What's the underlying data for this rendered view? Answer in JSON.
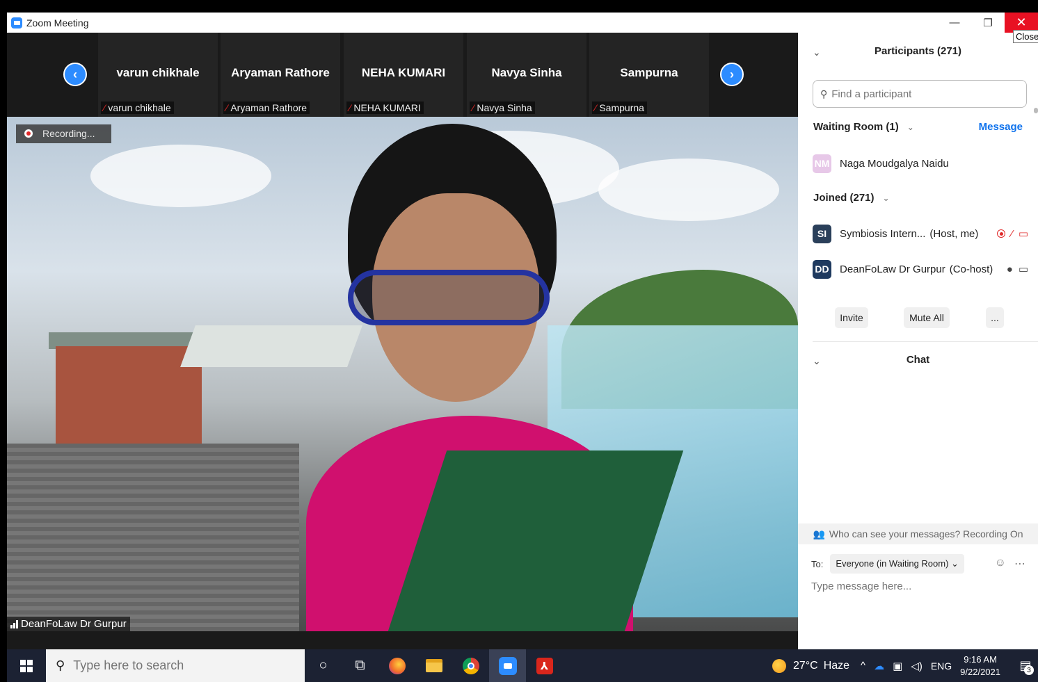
{
  "window": {
    "title": "Zoom Meeting",
    "minimize_glyph": "—",
    "restore_glyph": "❐",
    "close_glyph": "✕",
    "close_tooltip": "Close"
  },
  "thumbnails": {
    "prev_glyph": "‹",
    "next_glyph": "›",
    "items": [
      {
        "name": "varun chikhale",
        "label": "varun chikhale"
      },
      {
        "name": "Aryaman Rathore",
        "label": "Aryaman Rathore"
      },
      {
        "name": "NEHA KUMARI",
        "label": "NEHA KUMARI"
      },
      {
        "name": "Navya Sinha",
        "label": "Navya Sinha"
      },
      {
        "name": "Sampurna",
        "label": "Sampurna"
      }
    ]
  },
  "main_video": {
    "recording_label": "Recording...",
    "speaker_name": "DeanFoLaw Dr Gurpur"
  },
  "participants_panel": {
    "title": "Participants (271)",
    "search_placeholder": "Find a participant",
    "waiting_room": {
      "heading": "Waiting Room (1)",
      "message_label": "Message",
      "people": [
        {
          "initials": "NM",
          "name": "Naga Moudgalya Naidu",
          "color": "#e7c8e8"
        }
      ]
    },
    "joined": {
      "heading": "Joined (271)",
      "people": [
        {
          "initials": "SI",
          "name": "Symbiosis Intern...",
          "role": "(Host, me)",
          "color": "#2a3f5a"
        },
        {
          "initials": "DD",
          "name": "DeanFoLaw Dr Gurpur",
          "role": "(Co-host)",
          "color": "#1f3a5f"
        }
      ]
    },
    "buttons": {
      "invite": "Invite",
      "mute_all": "Mute All",
      "more": "..."
    }
  },
  "chat_panel": {
    "title": "Chat",
    "info": "Who can see your messages? Recording On",
    "to_label": "To:",
    "recipient": "Everyone (in Waiting Room)",
    "input_placeholder": "Type message here..."
  },
  "taskbar": {
    "search_placeholder": "Type here to search",
    "weather": "27°C",
    "weather_desc": "Haze",
    "language": "ENG",
    "time": "9:16 AM",
    "date": "9/22/2021",
    "notification_count": "3"
  },
  "colors": {
    "zoom_blue": "#2d8cff",
    "link_blue": "#0e72ed",
    "muted_red": "#e02828",
    "taskbar_bg": "#1c2233"
  }
}
